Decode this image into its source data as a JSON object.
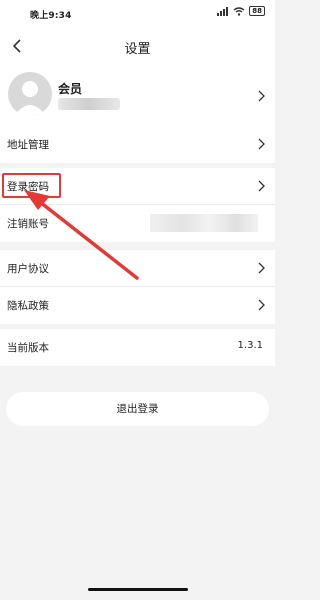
{
  "status_bar": {
    "time": "晚上9:34",
    "battery": "88"
  },
  "header": {
    "title": "设置"
  },
  "profile": {
    "label": "会员"
  },
  "settings": [
    {
      "label": "地址管理"
    },
    {
      "label": "登录密码"
    },
    {
      "label": "注销账号"
    },
    {
      "label": "用户协议"
    },
    {
      "label": "隐私政策"
    },
    {
      "label": "当前版本",
      "value": "1.3.1"
    }
  ],
  "logout": {
    "label": "退出登录"
  },
  "colors": {
    "highlight": "#e53935",
    "background": "#f3f3f3"
  }
}
